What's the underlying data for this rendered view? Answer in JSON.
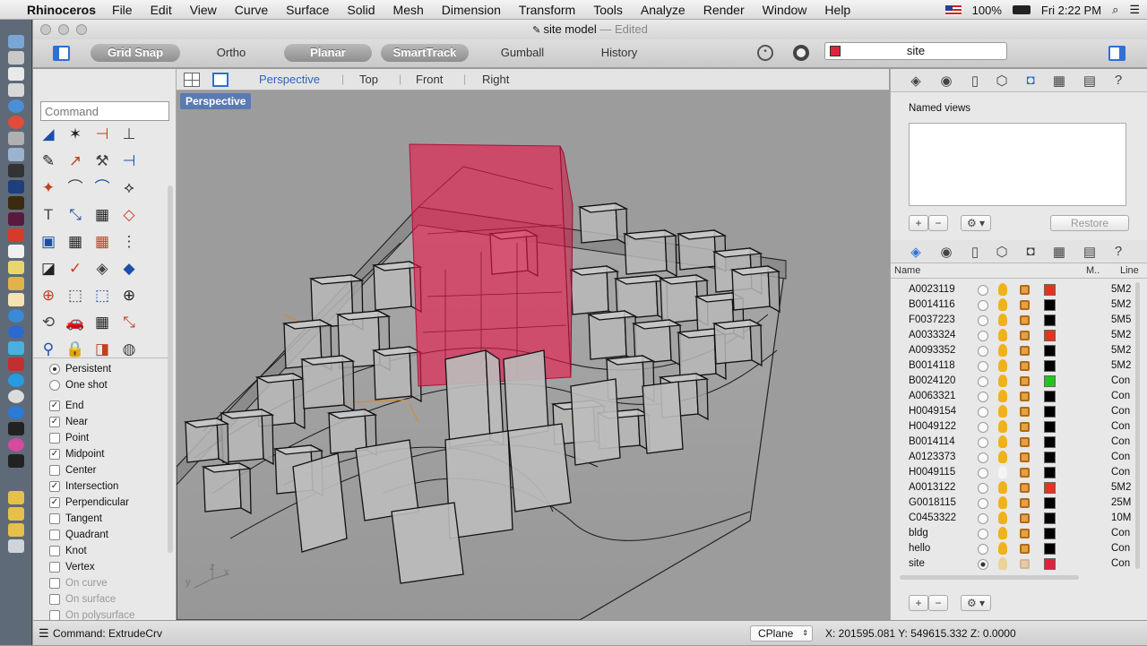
{
  "menubar": {
    "app": "Rhinoceros",
    "items": [
      "File",
      "Edit",
      "View",
      "Curve",
      "Surface",
      "Solid",
      "Mesh",
      "Dimension",
      "Transform",
      "Tools",
      "Analyze",
      "Render",
      "Window",
      "Help"
    ],
    "battery": "100%",
    "clock": "Fri 2:22 PM"
  },
  "window": {
    "title": "site model",
    "status": "Edited"
  },
  "toolbar": {
    "gridsnap": "Grid Snap",
    "ortho": "Ortho",
    "planar": "Planar",
    "smarttrack": "SmartTrack",
    "gumball": "Gumball",
    "history": "History",
    "current_layer": "site",
    "current_layer_color": "#e0223a"
  },
  "command": {
    "placeholder": "Command"
  },
  "viewtabs": {
    "perspective": "Perspective",
    "top": "Top",
    "front": "Front",
    "right": "Right"
  },
  "viewport": {
    "label": "Perspective",
    "axis_x": "x",
    "axis_y": "y",
    "axis_z": "z"
  },
  "osnap": {
    "persistent": "Persistent",
    "oneshot": "One shot",
    "end": "End",
    "near": "Near",
    "point": "Point",
    "midpoint": "Midpoint",
    "center": "Center",
    "intersection": "Intersection",
    "perpendicular": "Perpendicular",
    "tangent": "Tangent",
    "quadrant": "Quadrant",
    "knot": "Knot",
    "vertex": "Vertex",
    "oncurve": "On curve",
    "onsurface": "On surface",
    "onpolysurface": "On polysurface"
  },
  "namedviews": {
    "title": "Named views",
    "restore": "Restore",
    "add": "+",
    "remove": "−"
  },
  "layers": {
    "col_name": "Name",
    "col_m": "M..",
    "col_line": "Line",
    "rows": [
      {
        "name": "A0023119",
        "color": "#e8321e",
        "mat": "5M2"
      },
      {
        "name": "B0014116",
        "color": "#000000",
        "mat": "5M2"
      },
      {
        "name": "F0037223",
        "color": "#000000",
        "mat": "5M5"
      },
      {
        "name": "A0033324",
        "color": "#e8321e",
        "mat": "5M2"
      },
      {
        "name": "A0093352",
        "color": "#000000",
        "mat": "5M2"
      },
      {
        "name": "B0014118",
        "color": "#000000",
        "mat": "5M2"
      },
      {
        "name": "B0024120",
        "color": "#22c41e",
        "mat": "Con"
      },
      {
        "name": "A0063321",
        "color": "#000000",
        "mat": "Con"
      },
      {
        "name": "H0049154",
        "color": "#000000",
        "mat": "Con"
      },
      {
        "name": "H0049122",
        "color": "#000000",
        "mat": "Con"
      },
      {
        "name": "B0014114",
        "color": "#000000",
        "mat": "Con"
      },
      {
        "name": "A0123373",
        "color": "#000000",
        "mat": "Con"
      },
      {
        "name": "H0049115",
        "color": "#000000",
        "mat": "Con"
      },
      {
        "name": "A0013122",
        "color": "#e8321e",
        "mat": "5M2"
      },
      {
        "name": "G0018115",
        "color": "#000000",
        "mat": "25M"
      },
      {
        "name": "C0453322",
        "color": "#000000",
        "mat": "10M"
      },
      {
        "name": "bldg",
        "color": "#000000",
        "mat": "Con"
      },
      {
        "name": "hello",
        "color": "#000000",
        "mat": "Con"
      },
      {
        "name": "site",
        "color": "#e0223a",
        "mat": "Con"
      }
    ]
  },
  "status": {
    "command": "Command:  ExtrudeCrv",
    "cplane": "CPlane",
    "coords": "X: 201595.081  Y: 549615.332  Z: 0.0000"
  }
}
